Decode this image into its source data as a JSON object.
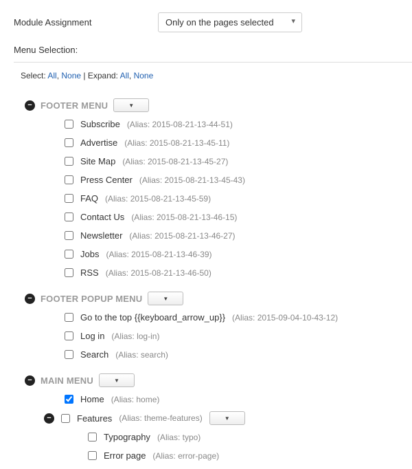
{
  "top": {
    "label": "Module Assignment",
    "selected": "Only on the pages selected"
  },
  "menuSelectionLabel": "Menu Selection:",
  "controls": {
    "selectLabel": "Select:",
    "selectAll": "All",
    "selectNone": "None",
    "expandLabel": "Expand:",
    "expandAll": "All",
    "expandNone": "None",
    "sep": ", ",
    "pipe": " | "
  },
  "menus": [
    {
      "key": "footer-menu",
      "title": "FOOTER MENU",
      "items": [
        {
          "label": "Subscribe",
          "alias": "(Alias: 2015-08-21-13-44-51)",
          "checked": false
        },
        {
          "label": "Advertise",
          "alias": "(Alias: 2015-08-21-13-45-11)",
          "checked": false
        },
        {
          "label": "Site Map",
          "alias": "(Alias: 2015-08-21-13-45-27)",
          "checked": false
        },
        {
          "label": "Press Center",
          "alias": "(Alias: 2015-08-21-13-45-43)",
          "checked": false
        },
        {
          "label": "FAQ",
          "alias": "(Alias: 2015-08-21-13-45-59)",
          "checked": false
        },
        {
          "label": "Contact Us",
          "alias": "(Alias: 2015-08-21-13-46-15)",
          "checked": false
        },
        {
          "label": "Newsletter",
          "alias": "(Alias: 2015-08-21-13-46-27)",
          "checked": false
        },
        {
          "label": "Jobs",
          "alias": "(Alias: 2015-08-21-13-46-39)",
          "checked": false
        },
        {
          "label": "RSS",
          "alias": "(Alias: 2015-08-21-13-46-50)",
          "checked": false
        }
      ]
    },
    {
      "key": "footer-popup-menu",
      "title": "FOOTER POPUP MENU",
      "items": [
        {
          "label": "Go to the top {{keyboard_arrow_up}}",
          "alias": "(Alias: 2015-09-04-10-43-12)",
          "checked": false
        },
        {
          "label": "Log in",
          "alias": "(Alias: log-in)",
          "checked": false
        },
        {
          "label": "Search",
          "alias": "(Alias: search)",
          "checked": false
        }
      ]
    }
  ],
  "mainMenu": {
    "title": "MAIN MENU",
    "home": {
      "label": "Home",
      "alias": "(Alias: home)",
      "checked": true
    },
    "features": {
      "label": "Features",
      "alias": "(Alias: theme-features)",
      "checked": false,
      "children": [
        {
          "label": "Typography",
          "alias": "(Alias: typo)",
          "checked": false
        },
        {
          "label": "Error page",
          "alias": "(Alias: error-page)",
          "checked": false
        }
      ]
    }
  }
}
